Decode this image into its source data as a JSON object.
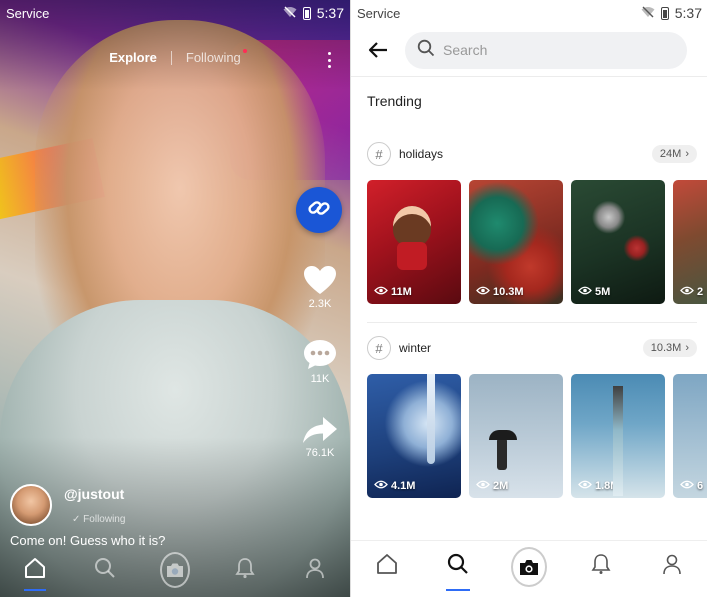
{
  "left": {
    "status": {
      "carrier": "Service",
      "time": "5:37"
    },
    "tabs": {
      "explore": "Explore",
      "following": "Following"
    },
    "actions": {
      "likes": "2.3K",
      "comments": "11K",
      "shares": "76.1K"
    },
    "creator": {
      "username": "@justout",
      "follow_state": "Following"
    },
    "caption": "Come on! Guess who it is?"
  },
  "right": {
    "status": {
      "carrier": "Service",
      "time": "5:37"
    },
    "search": {
      "placeholder": "Search"
    },
    "trending_title": "Trending",
    "sections": [
      {
        "tag": "holidays",
        "count": "24M",
        "thumbs": [
          {
            "views": "11M"
          },
          {
            "views": "10.3M"
          },
          {
            "views": "5M"
          },
          {
            "views": "2"
          }
        ]
      },
      {
        "tag": "winter",
        "count": "10.3M",
        "thumbs": [
          {
            "views": "4.1M"
          },
          {
            "views": "2M"
          },
          {
            "views": "1.8M"
          },
          {
            "views": "6"
          }
        ]
      }
    ]
  },
  "colors": {
    "accent": "#2e6cf6",
    "link_button": "#1a56d6",
    "notification_dot": "#ff2d55"
  }
}
